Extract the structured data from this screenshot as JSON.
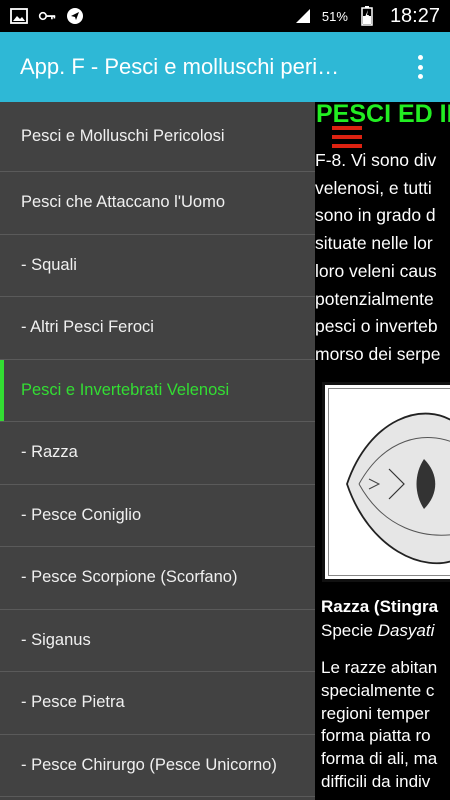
{
  "status_bar": {
    "left_icons": [
      "image-icon",
      "key-icon",
      "navigation-icon"
    ],
    "signal_icon": "signal-icon",
    "battery_percent": "51%",
    "battery_icon": "battery-charging-icon",
    "time": "18:27"
  },
  "app_bar": {
    "title": "App. F - Pesci e molluschi peri…",
    "overflow_icon": "more-vert-icon",
    "background": "#2eb8d6"
  },
  "drawer": {
    "items": [
      {
        "label": "Pesci e Molluschi Pericolosi",
        "active": false
      },
      {
        "label": "Pesci che Attaccano l'Uomo",
        "active": false
      },
      {
        "label": "- Squali",
        "active": false
      },
      {
        "label": "- Altri Pesci Feroci",
        "active": false
      },
      {
        "label": "Pesci e Invertebrati Velenosi",
        "active": true
      },
      {
        "label": "- Razza",
        "active": false
      },
      {
        "label": "- Pesce Coniglio",
        "active": false
      },
      {
        "label": "- Pesce Scorpione (Scorfano)",
        "active": false
      },
      {
        "label": "- Siganus",
        "active": false
      },
      {
        "label": "- Pesce Pietra",
        "active": false
      },
      {
        "label": "- Pesce Chirurgo (Pesce Unicorno)",
        "active": false
      }
    ],
    "active_color": "#33dd33",
    "background": "#424242"
  },
  "content": {
    "heading": "PESCI ED IN",
    "menu_icon": "hamburger-menu-icon",
    "paragraph_lines": [
      "F-8. Vi sono div",
      "velenosi, e tutti",
      "sono in grado d",
      "situate nelle lor",
      "loro veleni caus",
      "potenzialmente",
      "pesci o inverteb",
      "morso dei serpe"
    ],
    "figure_alt": "stingray-illustration",
    "caption_title": "Razza (Stingra",
    "caption_species_prefix": "Specie ",
    "caption_species_name": "Dasyati",
    "paragraph2_lines": [
      "Le razze abitan",
      "specialmente c",
      "regioni temper",
      "forma piatta ro",
      "forma di ali, ma",
      "difficili da indiv"
    ]
  }
}
